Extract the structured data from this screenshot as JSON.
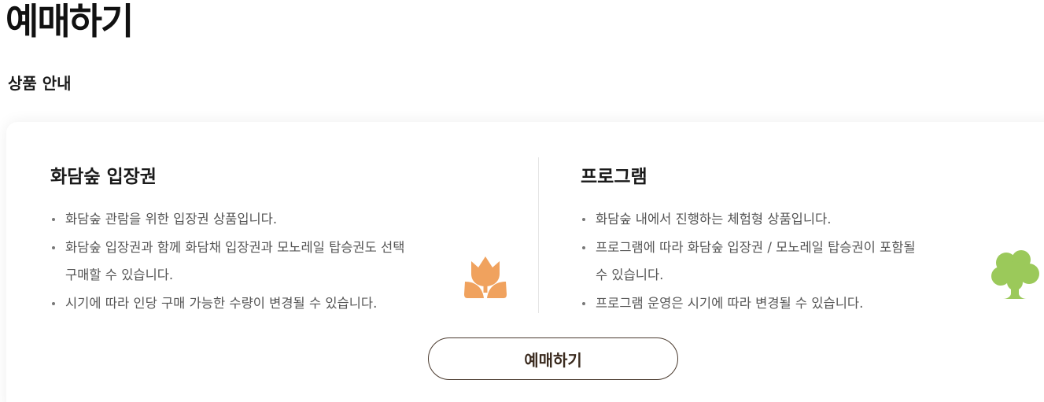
{
  "page": {
    "title": "예매하기"
  },
  "section": {
    "label": "상품 안내"
  },
  "products": [
    {
      "title": "화담숲 입장권",
      "bullets": [
        [
          "화담숲 관람을 위한 입장권 상품입니다."
        ],
        [
          "화담숲 입장권과 함께 화담채 입장권과 모노레일 탑승권도 선택",
          "구매할 수 있습니다."
        ],
        [
          "시기에 따라 인당 구매 가능한 수량이 변경될 수 있습니다."
        ]
      ],
      "icon": "tulip-icon",
      "icon_color": "#F0A25E"
    },
    {
      "title": "프로그램",
      "bullets": [
        [
          "화담숲 내에서 진행하는 체험형 상품입니다."
        ],
        [
          "프로그램에 따라 화담숲 입장권 / 모노레일 탑승권이 포함될",
          "수 있습니다."
        ],
        [
          "프로그램 운영은 시기에 따라 변경될 수 있습니다."
        ]
      ],
      "icon": "tree-icon",
      "icon_color": "#9BC95A"
    }
  ],
  "actions": {
    "book_label": "예매하기"
  },
  "colors": {
    "button_border": "#4A3A2E",
    "text_muted": "#555555"
  }
}
